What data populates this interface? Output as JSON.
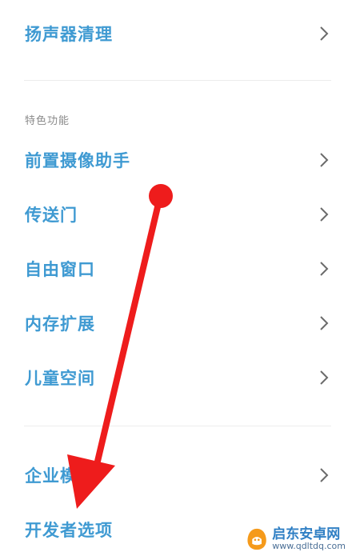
{
  "settings_list": {
    "speaker_clean": "扬声器清理",
    "section_special": "特色功能",
    "front_camera_assist": "前置摄像助手",
    "portal": "传送门",
    "free_window": "自由窗口",
    "memory_extension": "内存扩展",
    "kids_space": "儿童空间",
    "enterprise_mode": "企业模",
    "developer_options": "开发者选项"
  },
  "annotation": {
    "color": "#ee1c1c"
  },
  "watermark": {
    "title": "启东安卓网",
    "url": "www.qdltdq.com"
  },
  "colors": {
    "label": "#3f9ad2",
    "section_header": "#8a8a8a",
    "chevron": "#6b6b6b"
  }
}
